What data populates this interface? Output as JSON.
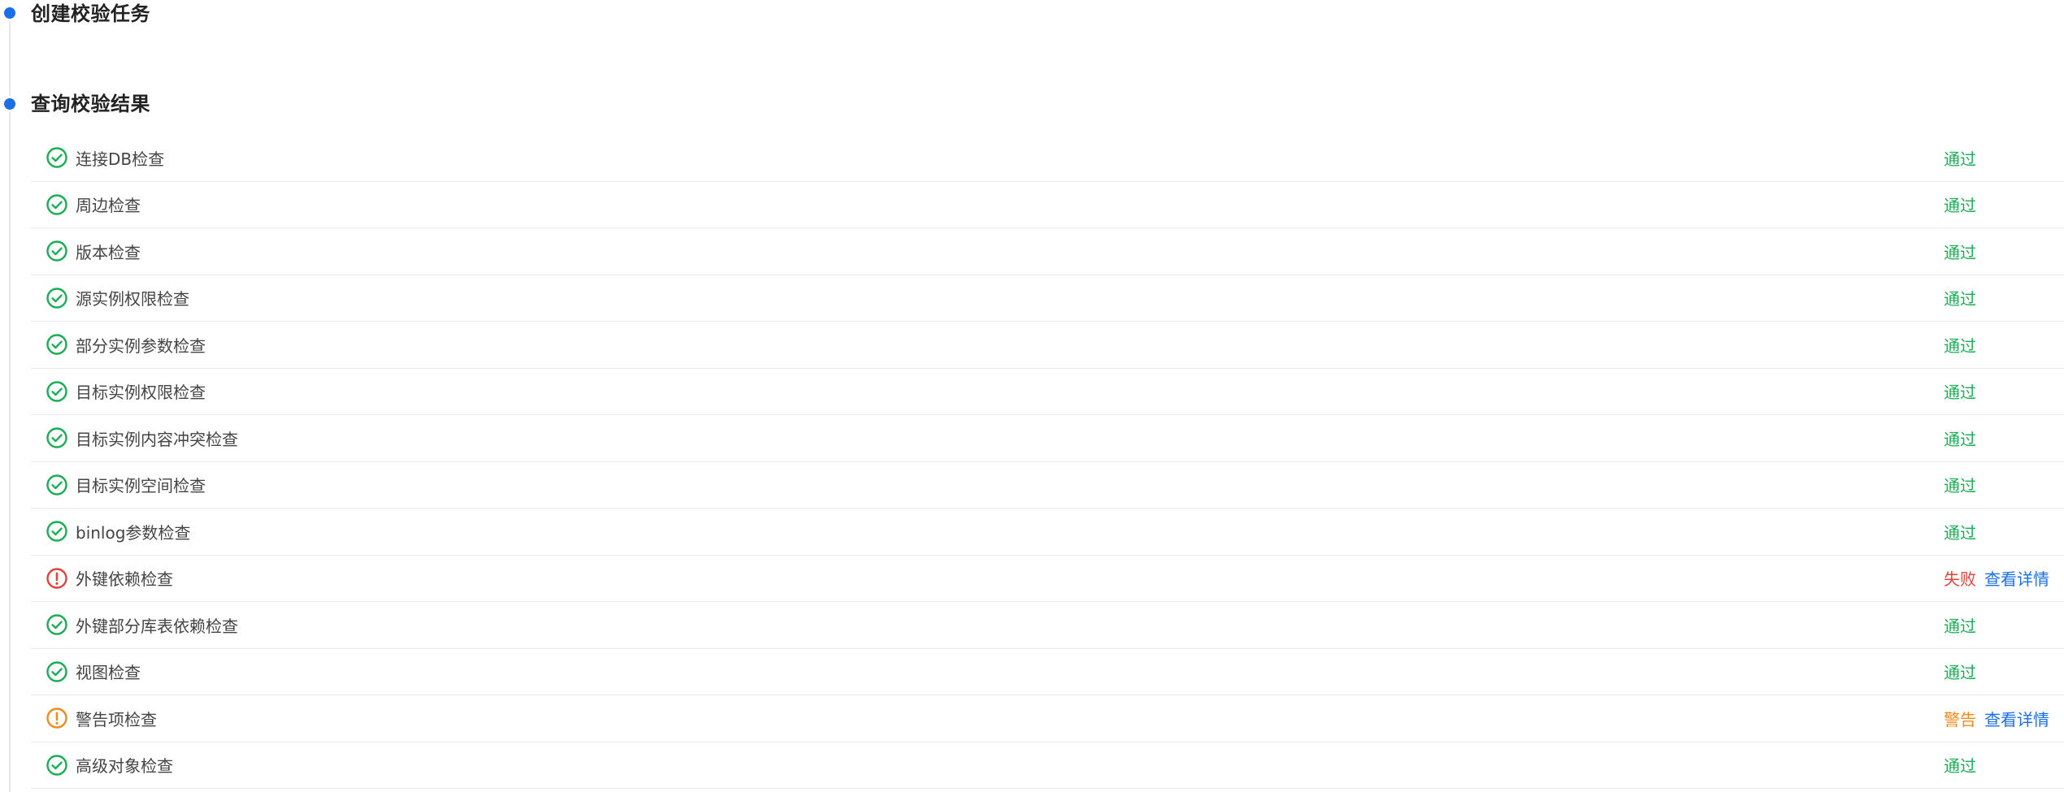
{
  "steps": {
    "create": {
      "title": "创建校验任务"
    },
    "query": {
      "title": "查询校验结果"
    }
  },
  "colors": {
    "accent": "#1a6fe8",
    "pass": "#1aad54",
    "fail": "#e0443a",
    "warn": "#f08a1c"
  },
  "checks": [
    {
      "name": "连接DB检查",
      "status": "pass",
      "icon": "check-circle-icon",
      "result": "通过"
    },
    {
      "name": "周边检查",
      "status": "pass",
      "icon": "check-circle-icon",
      "result": "通过"
    },
    {
      "name": "版本检查",
      "status": "pass",
      "icon": "check-circle-icon",
      "result": "通过"
    },
    {
      "name": "源实例权限检查",
      "status": "pass",
      "icon": "check-circle-icon",
      "result": "通过"
    },
    {
      "name": "部分实例参数检查",
      "status": "pass",
      "icon": "check-circle-icon",
      "result": "通过"
    },
    {
      "name": "目标实例权限检查",
      "status": "pass",
      "icon": "check-circle-icon",
      "result": "通过"
    },
    {
      "name": "目标实例内容冲突检查",
      "status": "pass",
      "icon": "check-circle-icon",
      "result": "通过"
    },
    {
      "name": "目标实例空间检查",
      "status": "pass",
      "icon": "check-circle-icon",
      "result": "通过"
    },
    {
      "name": "binlog参数检查",
      "status": "pass",
      "icon": "check-circle-icon",
      "result": "通过"
    },
    {
      "name": "外键依赖检查",
      "status": "fail",
      "icon": "exclamation-circle-icon",
      "result": "失败",
      "detail": "查看详情"
    },
    {
      "name": "外键部分库表依赖检查",
      "status": "pass",
      "icon": "check-circle-icon",
      "result": "通过"
    },
    {
      "name": "视图检查",
      "status": "pass",
      "icon": "check-circle-icon",
      "result": "通过"
    },
    {
      "name": "警告项检查",
      "status": "warn",
      "icon": "exclamation-circle-icon",
      "result": "警告",
      "detail": "查看详情"
    },
    {
      "name": "高级对象检查",
      "status": "pass",
      "icon": "check-circle-icon",
      "result": "通过"
    }
  ]
}
